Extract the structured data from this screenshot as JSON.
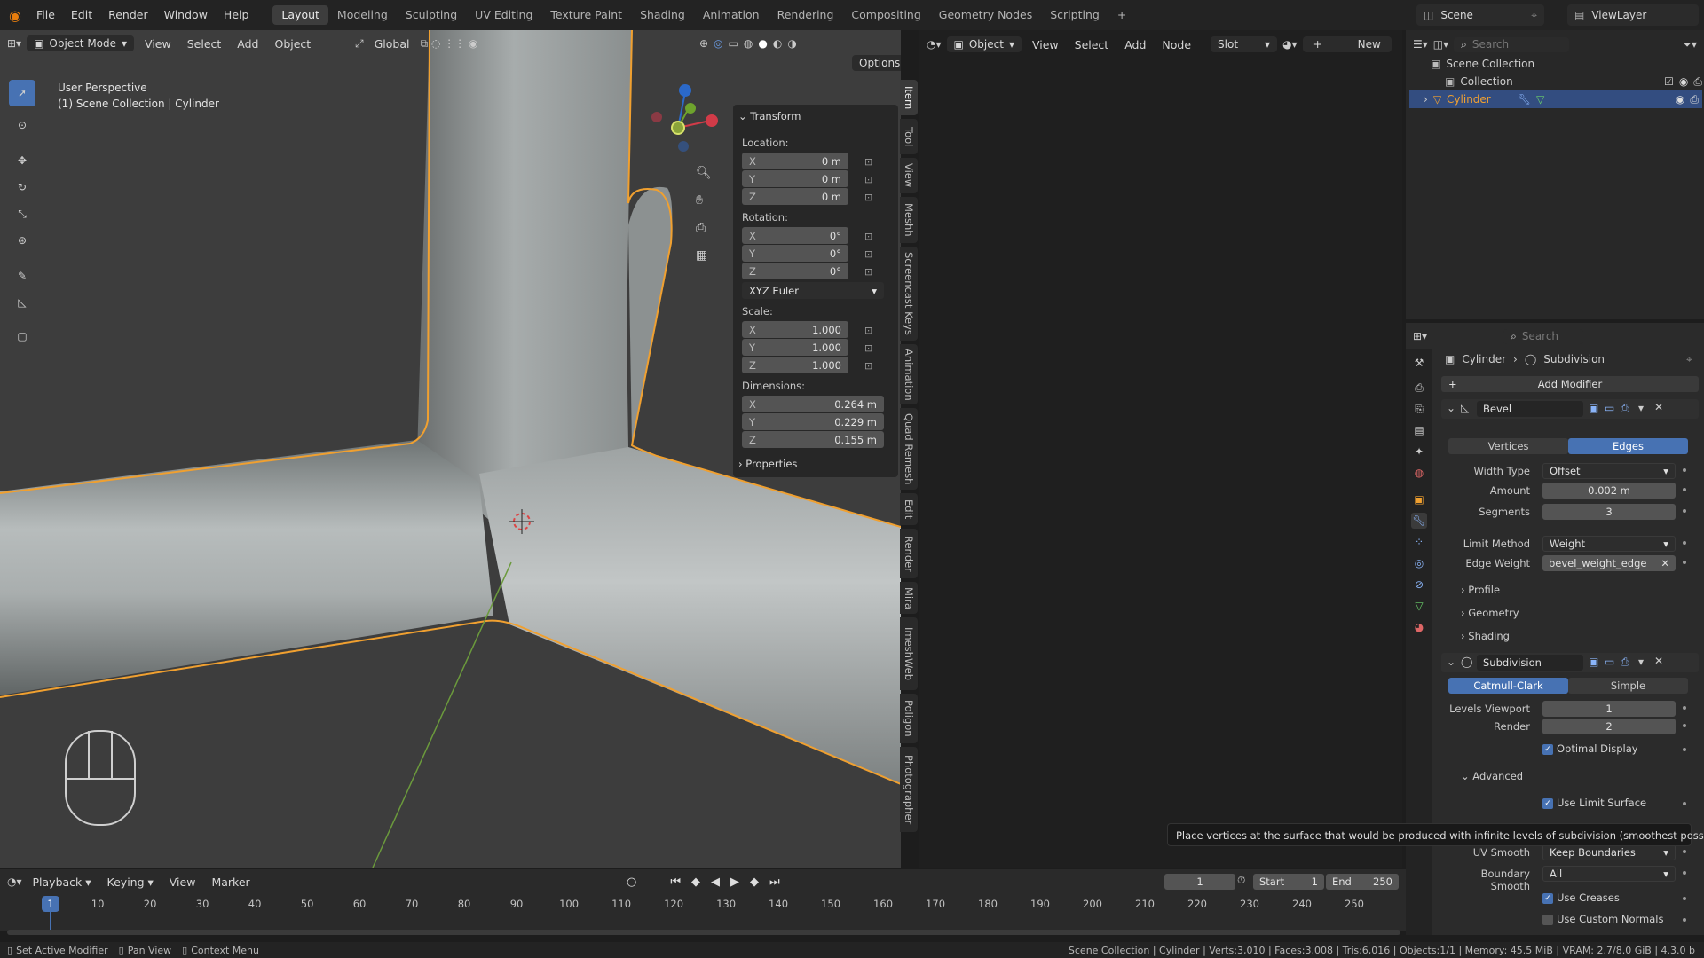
{
  "menu": [
    "File",
    "Edit",
    "Render",
    "Window",
    "Help"
  ],
  "workspaces": [
    "Layout",
    "Modeling",
    "Sculpting",
    "UV Editing",
    "Texture Paint",
    "Shading",
    "Animation",
    "Rendering",
    "Compositing",
    "Geometry Nodes",
    "Scripting"
  ],
  "active_workspace": "Layout",
  "scene": {
    "label": "Scene",
    "viewlayer": "ViewLayer"
  },
  "viewport": {
    "mode": "Object Mode",
    "menus": [
      "View",
      "Select",
      "Add",
      "Object"
    ],
    "orientation": "Global",
    "options": "Options",
    "perspective": "User Perspective",
    "context": "(1) Scene Collection | Cylinder",
    "side_tabs": [
      "Item",
      "Tool",
      "View",
      "Meshh",
      "Screencast Keys",
      "Animation",
      "Quad Remesh",
      "Edit",
      "Render",
      "Mira",
      "ImeshWeb",
      "Poligon",
      "Photographer"
    ]
  },
  "npanel": {
    "header": "Transform",
    "location_label": "Location:",
    "location": [
      {
        "axis": "X",
        "value": "0 m"
      },
      {
        "axis": "Y",
        "value": "0 m"
      },
      {
        "axis": "Z",
        "value": "0 m"
      }
    ],
    "rotation_label": "Rotation:",
    "rotation": [
      {
        "axis": "X",
        "value": "0°"
      },
      {
        "axis": "Y",
        "value": "0°"
      },
      {
        "axis": "Z",
        "value": "0°"
      }
    ],
    "rotation_mode": "XYZ Euler",
    "scale_label": "Scale:",
    "scale": [
      {
        "axis": "X",
        "value": "1.000"
      },
      {
        "axis": "Y",
        "value": "1.000"
      },
      {
        "axis": "Z",
        "value": "1.000"
      }
    ],
    "dimensions_label": "Dimensions:",
    "dimensions": [
      {
        "axis": "X",
        "value": "0.264 m"
      },
      {
        "axis": "Y",
        "value": "0.229 m"
      },
      {
        "axis": "Z",
        "value": "0.155 m"
      }
    ],
    "properties": "Properties"
  },
  "node_editor": {
    "type": "Object",
    "menus": [
      "View",
      "Select",
      "Add",
      "Node"
    ],
    "slot": "Slot",
    "new": "New"
  },
  "outliner": {
    "search_placeholder": "Search",
    "rows": [
      "Scene Collection",
      "Collection",
      "Cylinder"
    ]
  },
  "properties": {
    "search_placeholder": "Search",
    "breadcrumb_object": "Cylinder",
    "breadcrumb_modifier": "Subdivision",
    "add_modifier": "Add Modifier",
    "bevel": {
      "name": "Bevel",
      "tab_vertices": "Vertices",
      "tab_edges": "Edges",
      "width_type_label": "Width Type",
      "width_type": "Offset",
      "amount_label": "Amount",
      "amount": "0.002 m",
      "segments_label": "Segments",
      "segments": "3",
      "limit_method_label": "Limit Method",
      "limit_method": "Weight",
      "edge_weight_label": "Edge Weight",
      "edge_weight": "bevel_weight_edge",
      "sub_profile": "Profile",
      "sub_geometry": "Geometry",
      "sub_shading": "Shading"
    },
    "subdivision": {
      "name": "Subdivision",
      "tab_catmull": "Catmull-Clark",
      "tab_simple": "Simple",
      "levels_viewport_label": "Levels Viewport",
      "levels_viewport": "1",
      "render_label": "Render",
      "render": "2",
      "optimal_display": "Optimal Display",
      "advanced": "Advanced",
      "use_limit_surface": "Use Limit Surface",
      "uv_smooth_label": "UV Smooth",
      "uv_smooth": "Keep Boundaries",
      "boundary_smooth_label": "Boundary Smooth",
      "boundary_smooth": "All",
      "use_creases": "Use Creases",
      "use_custom_normals": "Use Custom Normals"
    }
  },
  "tooltip": "Place vertices at the surface that would be produced with infinite levels of subdivision (smoothest possible shape).",
  "timeline": {
    "menus": [
      "Playback",
      "Keying",
      "View",
      "Marker"
    ],
    "current_frame": "1",
    "start_label": "Start",
    "start": "1",
    "end_label": "End",
    "end": "250",
    "ticks": [
      "1",
      "10",
      "20",
      "30",
      "40",
      "50",
      "60",
      "70",
      "80",
      "90",
      "100",
      "110",
      "120",
      "130",
      "140",
      "150",
      "160",
      "170",
      "180",
      "190",
      "200",
      "210",
      "220",
      "230",
      "240",
      "250"
    ]
  },
  "status": {
    "left1": "Set Active Modifier",
    "left2": "Pan View",
    "left3": "Context Menu",
    "right": "Scene Collection | Cylinder | Verts:3,010 | Faces:3,008 | Tris:6,016 | Objects:1/1 | Memory: 45.5 MiB | VRAM: 2.7/8.0 GiB | 4.3.0 b"
  },
  "colors": {
    "accent": "#4772b3",
    "selection": "#f0a030",
    "viewport_bg": "#3d3d3d"
  }
}
